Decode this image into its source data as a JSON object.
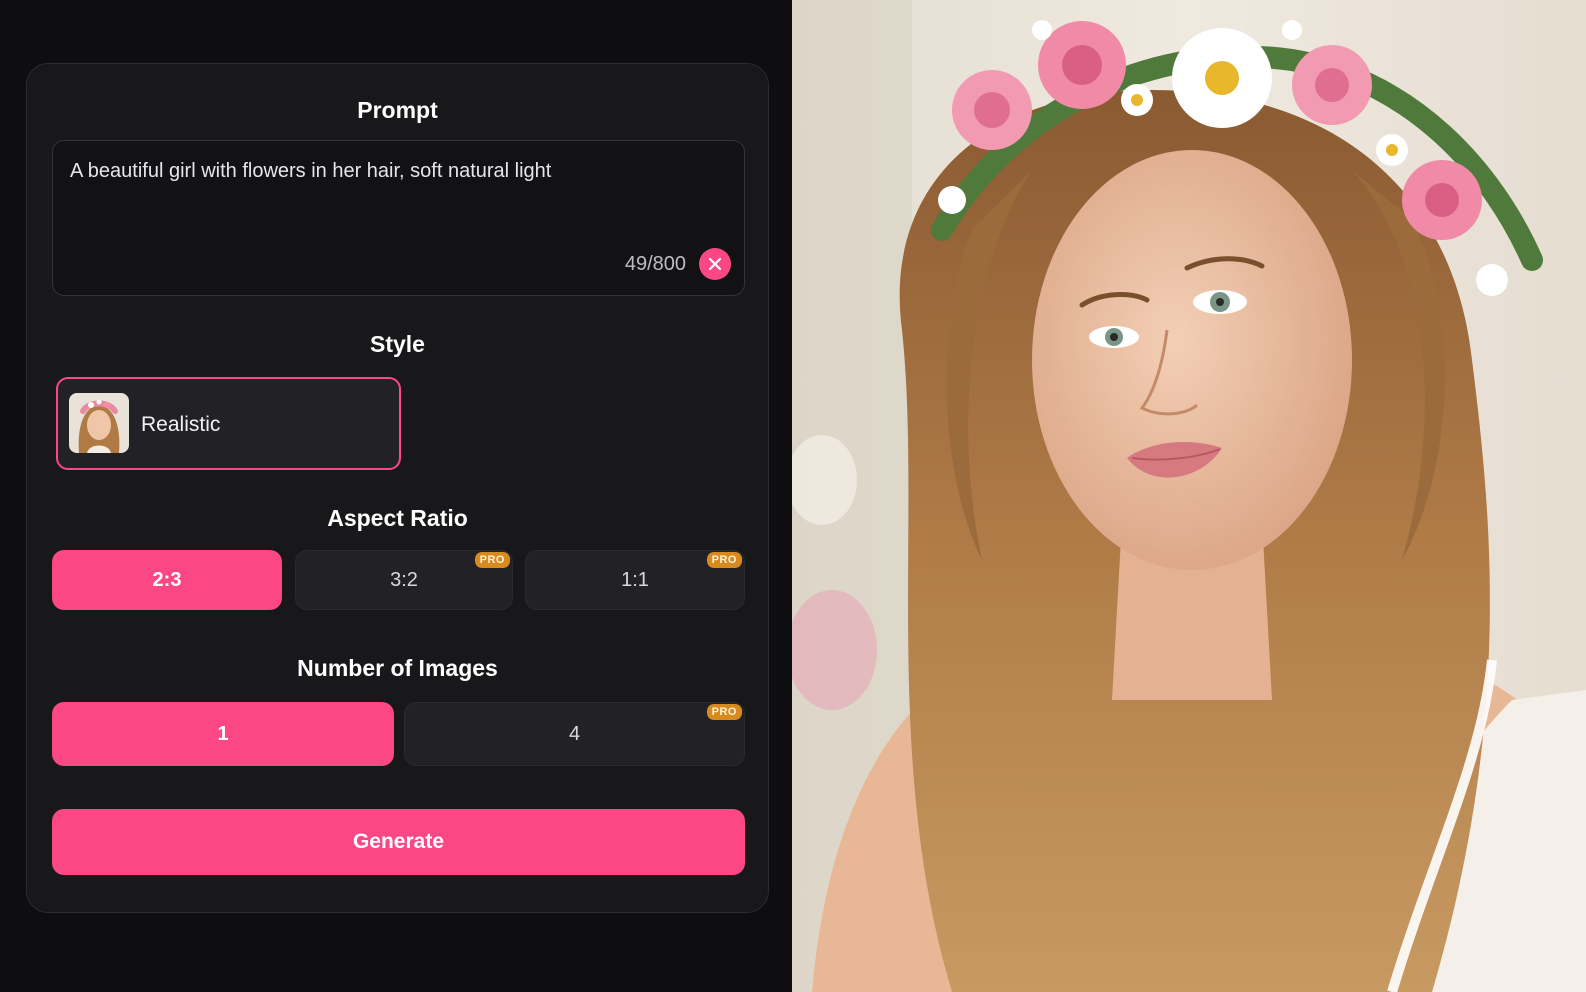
{
  "prompt": {
    "title": "Prompt",
    "value": "A beautiful girl with flowers in her hair, soft natural light",
    "char_count": "49/800",
    "clear_icon": "close-icon"
  },
  "style": {
    "title": "Style",
    "selected_label": "Realistic"
  },
  "aspect_ratio": {
    "title": "Aspect Ratio",
    "options": [
      {
        "label": "2:3",
        "selected": true,
        "pro": false
      },
      {
        "label": "3:2",
        "selected": false,
        "pro": true,
        "badge": "PRO"
      },
      {
        "label": "1:1",
        "selected": false,
        "pro": true,
        "badge": "PRO"
      }
    ]
  },
  "num_images": {
    "title": "Number of Images",
    "options": [
      {
        "label": "1",
        "selected": true,
        "pro": false
      },
      {
        "label": "4",
        "selected": false,
        "pro": true,
        "badge": "PRO"
      }
    ]
  },
  "generate": {
    "label": "Generate"
  },
  "colors": {
    "accent": "#fb4783",
    "pro_badge": "#d98a1e",
    "panel_bg": "#18181b",
    "page_bg": "#0e0e10"
  }
}
